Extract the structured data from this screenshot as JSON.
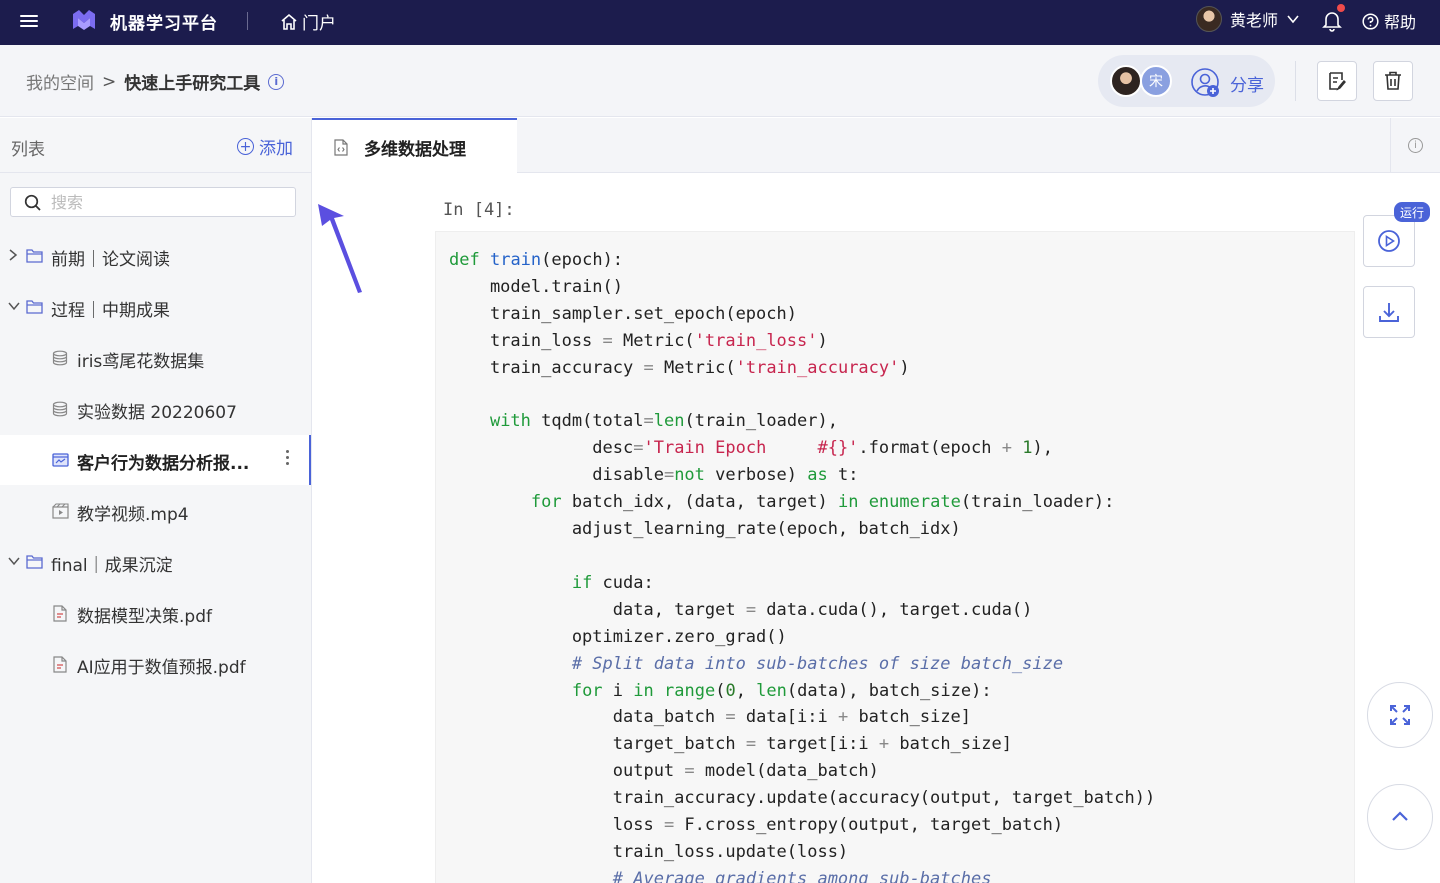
{
  "topbar": {
    "app_title": "机器学习平台",
    "portal_label": "门户",
    "user_name": "黄老师",
    "help_label": "帮助"
  },
  "breadcrumb": {
    "root": "我的空间",
    "separator": ">",
    "current": "快速上手研究工具"
  },
  "collab": {
    "second_avatar_initial": "宋",
    "share_label": "分享"
  },
  "sidebar": {
    "title": "列表",
    "add_label": "添加",
    "search_placeholder": "搜索",
    "items": [
      {
        "label": "前期｜论文阅读",
        "type": "folder",
        "expanded": false
      },
      {
        "label": "过程｜中期成果",
        "type": "folder",
        "expanded": true
      },
      {
        "label": "iris鸢尾花数据集",
        "type": "dataset"
      },
      {
        "label": "实验数据 20220607",
        "type": "dataset"
      },
      {
        "label": "客户行为数据分析报...",
        "type": "notebook",
        "active": true
      },
      {
        "label": "教学视频.mp4",
        "type": "video"
      },
      {
        "label": "final｜成果沉淀",
        "type": "folder",
        "expanded": true
      },
      {
        "label": "数据模型决策.pdf",
        "type": "pdf"
      },
      {
        "label": "AI应用于数值预报.pdf",
        "type": "pdf"
      }
    ]
  },
  "tab": {
    "label": "多维数据处理"
  },
  "cell": {
    "prompt": "In [4]:",
    "run_badge": "运行"
  },
  "colors": {
    "topbar_bg": "#1c1c4d",
    "accent": "#4a63d8",
    "keyword": "#1f9a3a",
    "string": "#c7254e"
  }
}
